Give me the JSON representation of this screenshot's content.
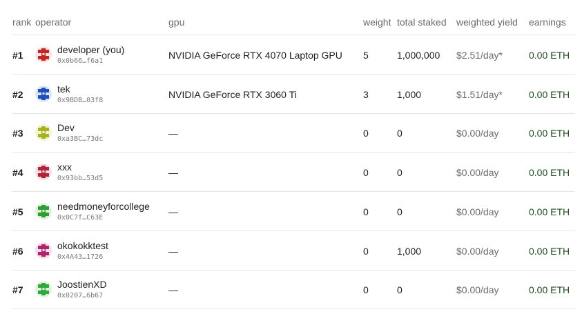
{
  "columns": {
    "rank": "rank",
    "operator": "operator",
    "gpu": "gpu",
    "weight": "weight",
    "total_staked": "total staked",
    "weighted_yield": "weighted yield",
    "earnings": "earnings"
  },
  "rows": [
    {
      "rank": "#1",
      "name": "developer (you)",
      "address": "0x0b66…f6a1",
      "gpu": "NVIDIA GeForce RTX 4070 Laptop GPU",
      "weight": "5",
      "total_staked": "1,000,000",
      "yield": "$2.51/day*",
      "earnings": "0.00 ETH",
      "avatar_color": "#c62828",
      "avatar_bg": "#fbe3e3"
    },
    {
      "rank": "#2",
      "name": "tek",
      "address": "0x9BDB…03f8",
      "gpu": "NVIDIA GeForce RTX 3060 Ti",
      "weight": "3",
      "total_staked": "1,000",
      "yield": "$1.51/day*",
      "earnings": "0.00 ETH",
      "avatar_color": "#1f4fb8",
      "avatar_bg": "#dde6f8"
    },
    {
      "rank": "#3",
      "name": "Dev",
      "address": "0xa3BC…73dc",
      "gpu": "—",
      "weight": "0",
      "total_staked": "0",
      "yield": "$0.00/day",
      "earnings": "0.00 ETH",
      "avatar_color": "#a8b21a",
      "avatar_bg": "#f3f5d6"
    },
    {
      "rank": "#4",
      "name": "xxx",
      "address": "0x93bb…53d5",
      "gpu": "—",
      "weight": "0",
      "total_staked": "0",
      "yield": "$0.00/day",
      "earnings": "0.00 ETH",
      "avatar_color": "#b0243a",
      "avatar_bg": "#f6dde1"
    },
    {
      "rank": "#5",
      "name": "needmoneyforcollege",
      "address": "0x0C7f…C63E",
      "gpu": "—",
      "weight": "0",
      "total_staked": "0",
      "yield": "$0.00/day",
      "earnings": "0.00 ETH",
      "avatar_color": "#2e9e2e",
      "avatar_bg": "#dff2df"
    },
    {
      "rank": "#6",
      "name": "okokokktest",
      "address": "0x4A43…1726",
      "gpu": "—",
      "weight": "0",
      "total_staked": "1,000",
      "yield": "$0.00/day",
      "earnings": "0.00 ETH",
      "avatar_color": "#b0246e",
      "avatar_bg": "#f6dde9"
    },
    {
      "rank": "#7",
      "name": "JoostienXD",
      "address": "0x0207…6b67",
      "gpu": "—",
      "weight": "0",
      "total_staked": "0",
      "yield": "$0.00/day",
      "earnings": "0.00 ETH",
      "avatar_color": "#2faa3a",
      "avatar_bg": "#dff3e1"
    }
  ]
}
